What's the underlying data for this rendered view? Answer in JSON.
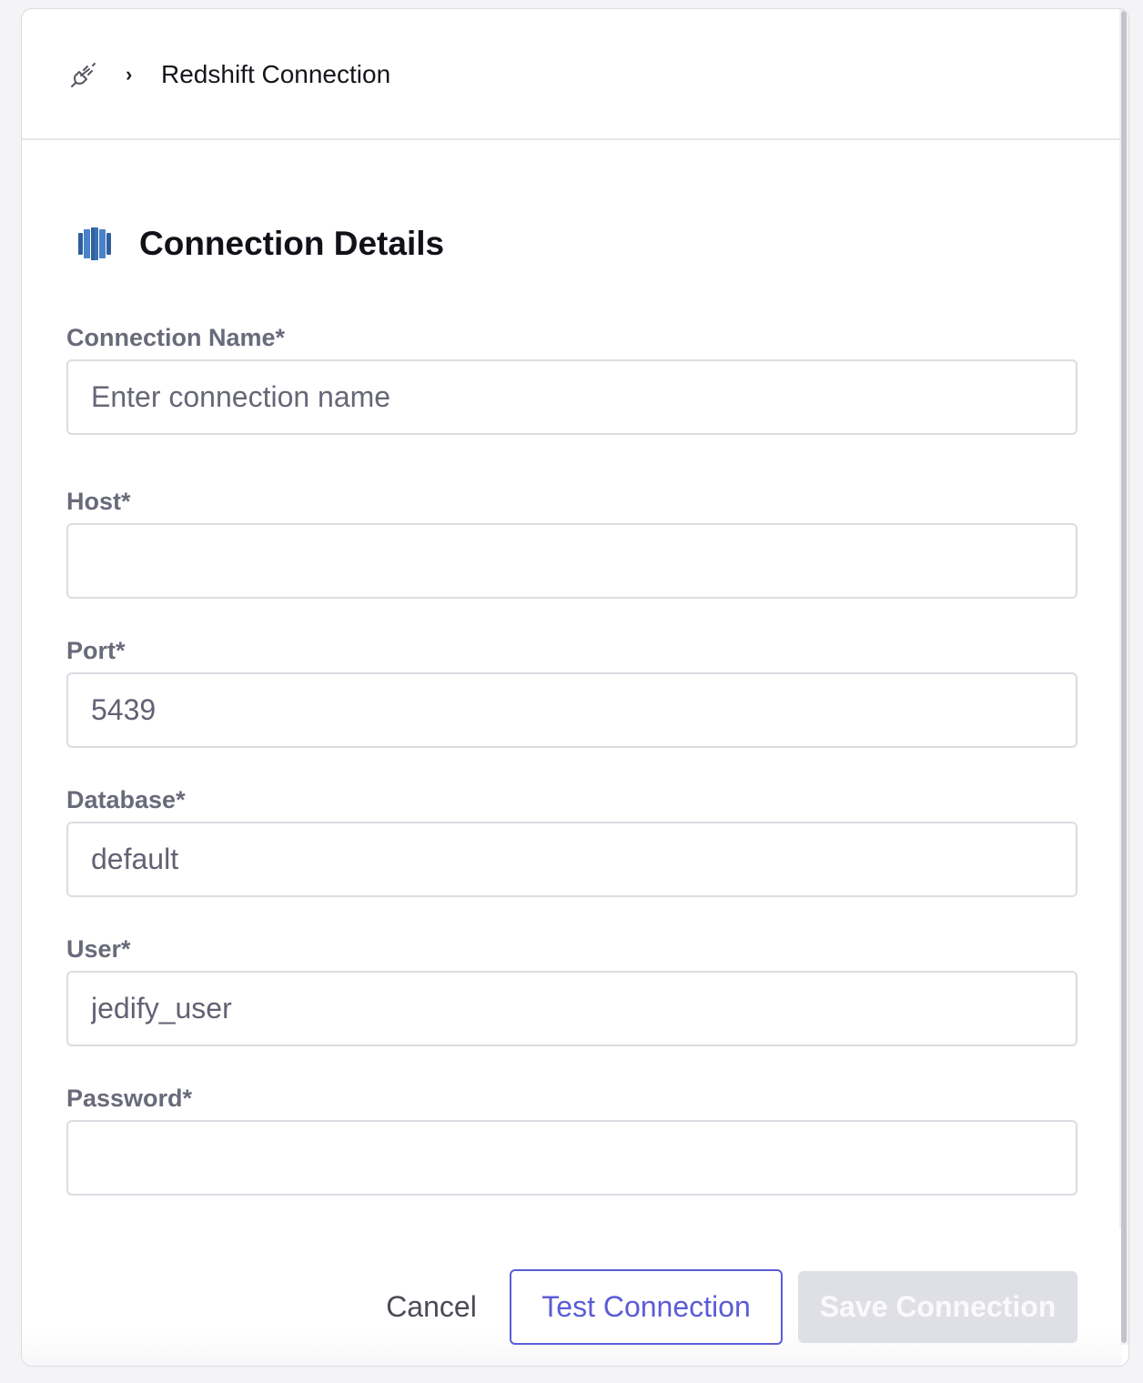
{
  "breadcrumb": {
    "root_icon": "plug-icon",
    "separator": "›",
    "current": "Redshift Connection"
  },
  "section": {
    "icon": "redshift-logo-icon",
    "title": "Connection Details"
  },
  "fields": {
    "connection_name": {
      "label": "Connection Name*",
      "value": "",
      "placeholder": "Enter connection name"
    },
    "host": {
      "label": "Host*",
      "value": "",
      "placeholder": ""
    },
    "port": {
      "label": "Port*",
      "value": "5439",
      "placeholder": ""
    },
    "database": {
      "label": "Database*",
      "value": "default",
      "placeholder": ""
    },
    "user": {
      "label": "User*",
      "value": "jedify_user",
      "placeholder": ""
    },
    "password": {
      "label": "Password*",
      "value": "",
      "placeholder": ""
    }
  },
  "actions": {
    "cancel_label": "Cancel",
    "test_label": "Test Connection",
    "save_label": "Save Connection"
  },
  "colors": {
    "accent": "#5b5cd6",
    "label": "#696a7a",
    "disabled_button": "#dfdfe6",
    "redshift_blue": "#3a6fb0"
  }
}
